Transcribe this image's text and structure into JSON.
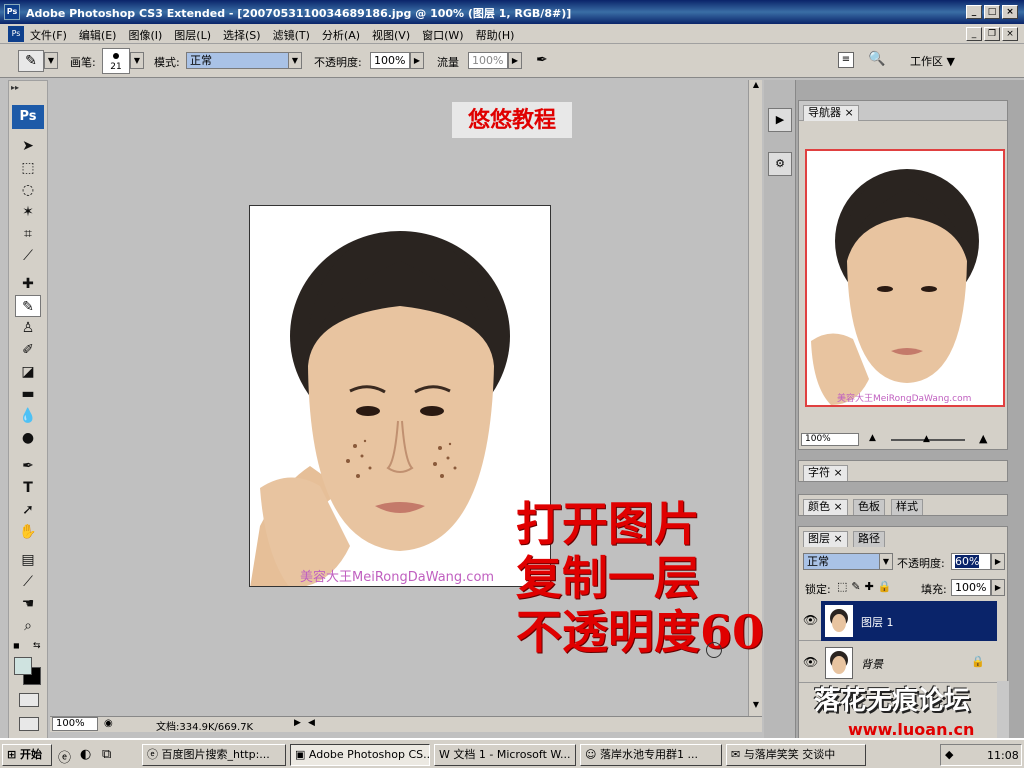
{
  "window": {
    "app_icon": "Ps",
    "title": "Adobe Photoshop CS3 Extended - [20070531100346891​86.jpg @ 100% (图层 1, RGB/8#)]"
  },
  "menu": {
    "items": [
      "文件(F)",
      "编辑(E)",
      "图像(I)",
      "图层(L)",
      "选择(S)",
      "滤镜(T)",
      "分析(A)",
      "视图(V)",
      "窗口(W)",
      "帮助(H)"
    ]
  },
  "options": {
    "brush_label": "画笔:",
    "brush_size": "21",
    "mode_label": "模式:",
    "mode_value": "正常",
    "opacity_label": "不透明度:",
    "opacity_value": "100%",
    "flow_label": "流量",
    "flow_value": "100%",
    "overlay_title": "悠悠教程",
    "workspace_label": "工作区"
  },
  "document": {
    "watermark": "美容大王MeiRongDaWang.com",
    "annotation_lines": [
      "打开图片",
      "复制一层",
      "不透明度60"
    ]
  },
  "status": {
    "zoom": "100%",
    "doc_size": "文档:334.9K/669.7K"
  },
  "navigator": {
    "tab": "导航器",
    "zoom": "100%",
    "watermark": "美容大王MeiRongDaWang.com"
  },
  "panels": {
    "character_tab": "字符",
    "color_tab": "颜色",
    "swatches_tab": "色板",
    "styles_tab": "样式",
    "layers_tab": "图层",
    "paths_tab": "路径"
  },
  "layers": {
    "blend_mode": "正常",
    "opacity_label": "不透明度:",
    "opacity_value": "60%",
    "lock_label": "锁定:",
    "fill_label": "填充:",
    "fill_value": "100%",
    "items": [
      {
        "name": "图层 1",
        "selected": true
      },
      {
        "name": "背景",
        "selected": false
      }
    ]
  },
  "forum_logo": "落花无痕论坛",
  "site_url": "www.luoan.cn",
  "taskbar": {
    "start": "开始",
    "tasks": [
      "百度图片搜索_http:...",
      "Adobe Photoshop CS...",
      "文档 1 - Microsoft W...",
      "落岸水池专用群1 ...",
      "与落岸笑笑 交谈中"
    ],
    "clock": "11:08"
  },
  "colors": {
    "title_bar": "#0a246a",
    "selection": "#0a246a",
    "annotation_red": "#e00000"
  }
}
